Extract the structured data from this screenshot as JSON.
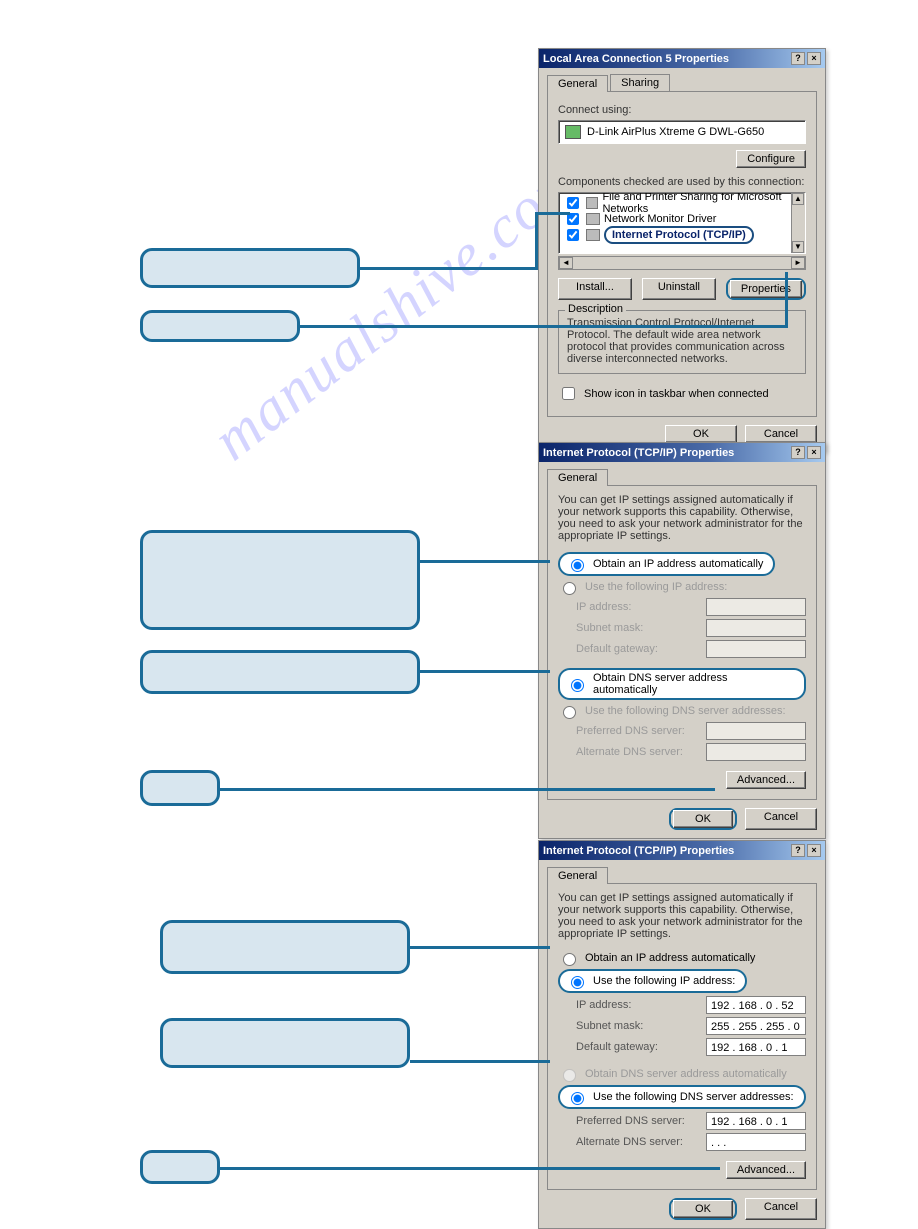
{
  "watermark": "manualshive.com",
  "dialog1": {
    "title": "Local Area Connection 5 Properties",
    "tabs": [
      "General",
      "Sharing"
    ],
    "connect_using_label": "Connect using:",
    "adapter": "D-Link AirPlus Xtreme G DWL-G650",
    "configure": "Configure",
    "components_label": "Components checked are used by this connection:",
    "components": [
      {
        "checked": true,
        "text": "File and Printer Sharing for Microsoft Networks"
      },
      {
        "checked": true,
        "text": "Network Monitor Driver"
      },
      {
        "checked": true,
        "text": "Internet Protocol (TCP/IP)",
        "selected": true
      }
    ],
    "install": "Install...",
    "uninstall": "Uninstall",
    "properties": "Properties",
    "description_label": "Description",
    "description_text": "Transmission Control Protocol/Internet Protocol. The default wide area network protocol that provides communication across diverse interconnected networks.",
    "show_icon": "Show icon in taskbar when connected",
    "ok": "OK",
    "cancel": "Cancel"
  },
  "dialog2": {
    "title": "Internet Protocol (TCP/IP) Properties",
    "tab": "General",
    "intro": "You can get IP settings assigned automatically if your network supports this capability. Otherwise, you need to ask your network administrator for the appropriate IP settings.",
    "r_ip_auto": "Obtain an IP address automatically",
    "r_ip_manual": "Use the following IP address:",
    "ip_label": "IP address:",
    "mask_label": "Subnet mask:",
    "gw_label": "Default gateway:",
    "r_dns_auto": "Obtain DNS server address automatically",
    "r_dns_manual": "Use the following DNS server addresses:",
    "pdns_label": "Preferred DNS server:",
    "adns_label": "Alternate DNS server:",
    "advanced": "Advanced...",
    "ok": "OK",
    "cancel": "Cancel"
  },
  "dialog3": {
    "title": "Internet Protocol (TCP/IP) Properties",
    "tab": "General",
    "intro": "You can get IP settings assigned automatically if your network supports this capability. Otherwise, you need to ask your network administrator for the appropriate IP settings.",
    "r_ip_auto": "Obtain an IP address automatically",
    "r_ip_manual": "Use the following IP address:",
    "ip_label": "IP address:",
    "ip_value": "192 . 168 .  0  .  52",
    "mask_label": "Subnet mask:",
    "mask_value": "255 . 255 . 255 .  0",
    "gw_label": "Default gateway:",
    "gw_value": "192 . 168 .  0  .  1",
    "r_dns_auto": "Obtain DNS server address automatically",
    "r_dns_manual": "Use the following DNS server addresses:",
    "pdns_label": "Preferred DNS server:",
    "pdns_value": "192 . 168 .  0  .  1",
    "adns_label": "Alternate DNS server:",
    "adns_value": " .       .       .  ",
    "advanced": "Advanced...",
    "ok": "OK",
    "cancel": "Cancel"
  }
}
